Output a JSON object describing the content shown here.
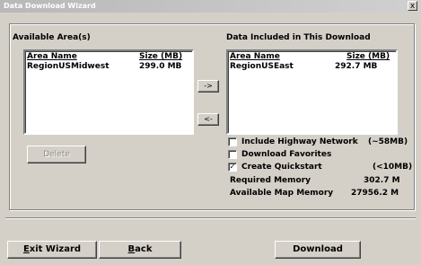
{
  "window": {
    "title": "Data Download Wizard",
    "close_label": "x"
  },
  "available": {
    "heading": "Available Area(s)",
    "col_name": "Area Name",
    "col_size": "Size (MB)",
    "rows": [
      {
        "name": "RegionUSMidwest",
        "size": "299.0 MB"
      }
    ]
  },
  "included": {
    "heading": "Data Included in This Download",
    "col_name": "Area Name",
    "col_size": "Size (MB)",
    "rows": [
      {
        "name": "RegionUSEast",
        "size": "292.7 MB"
      }
    ]
  },
  "transfer": {
    "add_label": "->",
    "remove_label": "<-"
  },
  "delete_label": "Delete",
  "options": {
    "highway": {
      "label": "Include Highway Network",
      "value": "(~58MB)",
      "checked": false
    },
    "favorites": {
      "label": "Download Favorites",
      "checked": false
    },
    "quickstart": {
      "label": "Create Quickstart",
      "value": "(<10MB)",
      "checked": true
    }
  },
  "memory": {
    "required_label": "Required Memory",
    "required_value": "302.7 M",
    "available_label": "Available Map Memory",
    "available_value": "27956.2 M"
  },
  "footer": {
    "exit_first": "E",
    "exit_rest": "xit Wizard",
    "back_first": "B",
    "back_rest": "ack",
    "download_label": "Download"
  }
}
